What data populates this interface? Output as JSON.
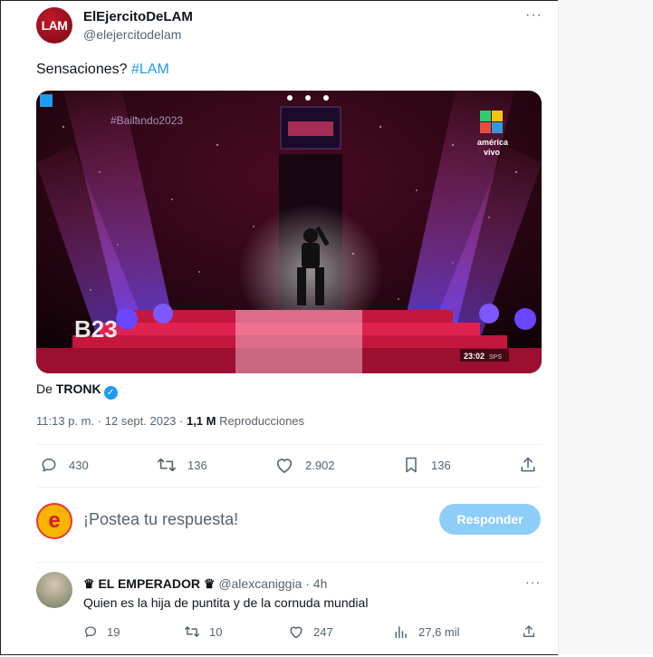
{
  "tweet": {
    "avatar_text": "LAM",
    "display_name": "ElEjercitoDeLAM",
    "handle": "@elejercitodelam",
    "more": "···",
    "text": "Sensaciones? ",
    "hashtag": "#LAM",
    "media": {
      "hashtag_overlay": "#Bailando2023",
      "logo_text": "B23",
      "channel_line1": "américa",
      "channel_line2": "vivo",
      "clock": "23:02",
      "clock_suffix": "SPS"
    },
    "from_prefix": "De ",
    "from_name": "TRONK",
    "time": "11:13 p. m. · 12 sept. 2023 · ",
    "views_count": "1,1 M",
    "views_label": " Reproducciones",
    "actions": {
      "replies": "430",
      "retweets": "136",
      "likes": "2.902",
      "bookmarks": "136"
    }
  },
  "composer": {
    "avatar_text": "e",
    "placeholder": "¡Postea tu respuesta!",
    "button": "Responder"
  },
  "reply": {
    "name": "♛ EL EMPERADOR ♛",
    "handle": "@alexcaniggia · 4h",
    "more": "···",
    "text": "Quien es la hija de puntita y de la cornuda mundial",
    "actions": {
      "replies": "19",
      "retweets": "10",
      "likes": "247",
      "views": "27,6 mil"
    }
  },
  "colors": {
    "accent": "#1d9bf0",
    "muted": "#536471",
    "reply_button": "#8ecdf8"
  },
  "icons": [
    "reply-icon",
    "retweet-icon",
    "like-icon",
    "bookmark-icon",
    "share-icon",
    "views-icon",
    "more-icon",
    "verified-badge-icon"
  ]
}
